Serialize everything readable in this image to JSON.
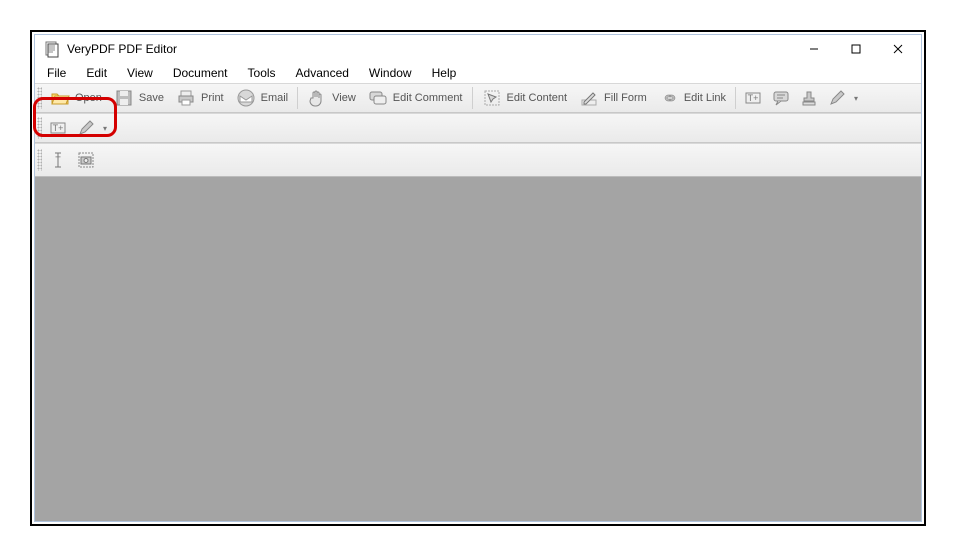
{
  "title": "VeryPDF PDF Editor",
  "menu": {
    "file": "File",
    "edit": "Edit",
    "view": "View",
    "document": "Document",
    "tools": "Tools",
    "advanced": "Advanced",
    "window": "Window",
    "help": "Help"
  },
  "toolbar": {
    "open": "Open",
    "save": "Save",
    "print": "Print",
    "email": "Email",
    "view": "View",
    "editComment": "Edit Comment",
    "editContent": "Edit Content",
    "fillForm": "Fill Form",
    "editLink": "Edit Link"
  }
}
